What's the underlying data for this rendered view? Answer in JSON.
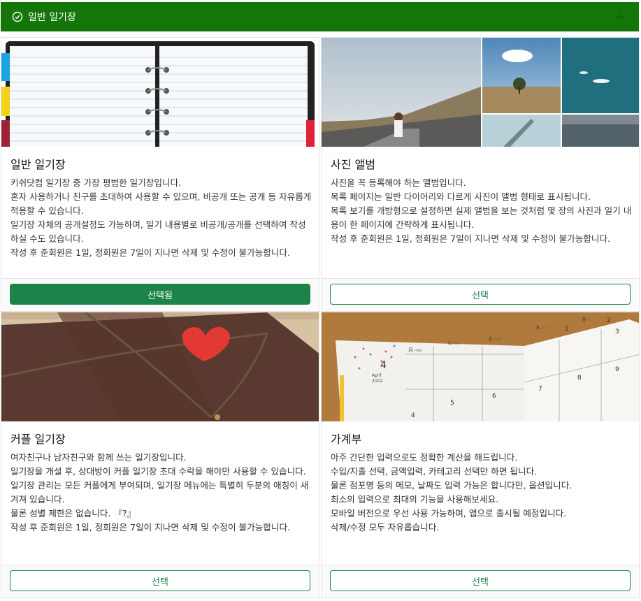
{
  "header": {
    "title": "일반 일기장",
    "accent": "#147508"
  },
  "cards": [
    {
      "title": "일반 일기장",
      "lines": [
        "키쉬닷컴 일기장 중 가장 평범한 일기장입니다.",
        "혼자 사용하거나 친구를 초대하여 사용할 수 있으며, 비공개 또는 공개 등 자유롭게 적용할 수 있습니다.",
        "일기장 자체의 공개설정도 가능하며, 일기 내용별로 비공개/공개를 선택하여 작성하실 수도 있습니다.",
        "작성 후 준회원은 1일, 정회원은 7일이 지나면 삭제 및 수정이 불가능합니다."
      ],
      "button": "선택됨",
      "selected": true
    },
    {
      "title": "사진 앨범",
      "lines": [
        "사진을 꼭 등록해야 하는 앨범입니다.",
        "목록 페이지는 일반 다이어리와 다르게 사진이 앨범 형태로 표시됩니다.",
        "목록 보기를 개방형으로 설정하면 실제 앨범을 보는 것처럼 몇 장의 사진과 일기 내용이 한 페이지에 간략하게 표시됩니다.",
        "작성 후 준회원은 1일, 정회원은 7일이 지나면 삭제 및 수정이 불가능합니다."
      ],
      "button": "선택",
      "selected": false
    },
    {
      "title": "커플 일기장",
      "lines": [
        "여자친구나 남자친구와 함께 쓰는 일기장입니다.",
        "일기장을 개설 후, 상대방이 커플 일기장 초대 수락을 해야만 사용할 수 있습니다.",
        "일기장 관리는 모든 커플에게 부여되며, 일기장 메뉴에는 특별히 두분의 애칭이 새겨져 있습니다.",
        "물론 성별 제한은 없습니다. 『?』",
        "작성 후 준회원은 1일, 정회원은 7일이 지나면 삭제 및 수정이 불가능합니다."
      ],
      "button": "선택",
      "selected": false
    },
    {
      "title": "가계부",
      "lines": [
        "아주 간단한 입력으로도 정확한 계산을 해드립니다.",
        "수입/지출 선택, 금액입력, 카테고리 선택만 하면 됩니다.",
        "물론 점포명 등의 메모, 날짜도 입력 가능은 합니다만, 옵션입니다.",
        "최소의 입력으로 최대의 기능을 사용해보세요.",
        "모바일 버전으로 우선 사용 가능하며, 앱으로 출시될 예정입니다.",
        "삭제/수정 모두 자유롭습니다."
      ],
      "button": "선택",
      "selected": false
    }
  ],
  "planner": {
    "month_label": "April",
    "day_num": "4",
    "year_label": "2022",
    "days": [
      "1",
      "2",
      "3",
      "4",
      "5",
      "6",
      "7",
      "8",
      "9"
    ],
    "weekday_abbr": [
      "mon",
      "tue",
      "wed",
      "thu",
      "fri"
    ],
    "weekday_kanji": [
      "月",
      "火",
      "水",
      "木",
      "金"
    ]
  }
}
